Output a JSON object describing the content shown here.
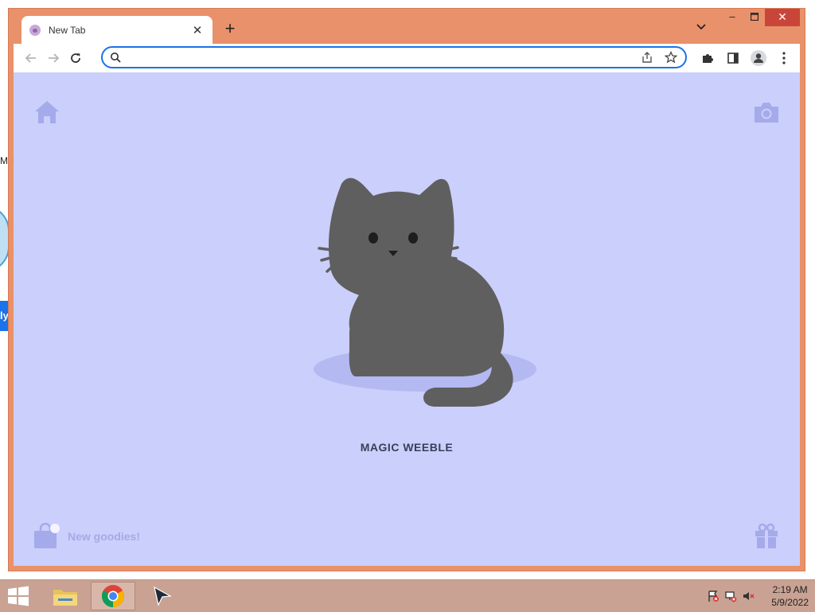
{
  "browser": {
    "tab": {
      "title": "New Tab"
    },
    "address_bar": {
      "value": "",
      "placeholder": ""
    }
  },
  "page": {
    "pet_name": "MAGIC WEEBLE",
    "goodies_label": "New goodies!"
  },
  "taskbar": {
    "time": "2:19 AM",
    "date": "5/9/2022"
  },
  "background": {
    "fragment_1": "Ma",
    "fragment_2": "ly"
  },
  "colors": {
    "window_frame": "#e9916a",
    "page_background": "#cbcffb",
    "accent": "#1a73e8",
    "cat": "#5f5f5f",
    "taskbar": "#c9a293"
  }
}
